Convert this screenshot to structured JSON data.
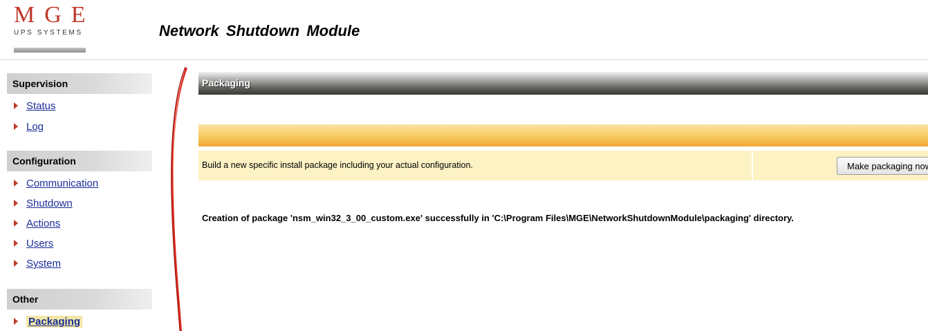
{
  "logo": {
    "main": "MGE",
    "sub": "UPS SYSTEMS"
  },
  "app": {
    "title": "Network Shutdown Module"
  },
  "sidebar": {
    "sections": [
      {
        "header": "Supervision",
        "items": [
          {
            "label": "Status"
          },
          {
            "label": "Log"
          }
        ]
      },
      {
        "header": "Configuration",
        "items": [
          {
            "label": "Communication"
          },
          {
            "label": "Shutdown"
          },
          {
            "label": "Actions"
          },
          {
            "label": "Users"
          },
          {
            "label": "System"
          }
        ]
      },
      {
        "header": "Other",
        "items": [
          {
            "label": "Packaging",
            "active": true
          }
        ]
      }
    ]
  },
  "main": {
    "section_title": "Packaging",
    "description": "Build a new specific install package including your actual configuration.",
    "button_label": "Make packaging now",
    "result_message": "Creation of package 'nsm_win32_3_00_custom.exe' successfully in 'C:\\Program Files\\MGE\\NetworkShutdownModule\\packaging' directory."
  },
  "colors": {
    "brand_red": "#c0392b",
    "link_blue": "#1a2e9a",
    "section_header_dark": "#3a3a34",
    "orange_band": "#efa934",
    "info_bg": "#fdf2c4",
    "active_highlight": "#f1e6a5"
  }
}
